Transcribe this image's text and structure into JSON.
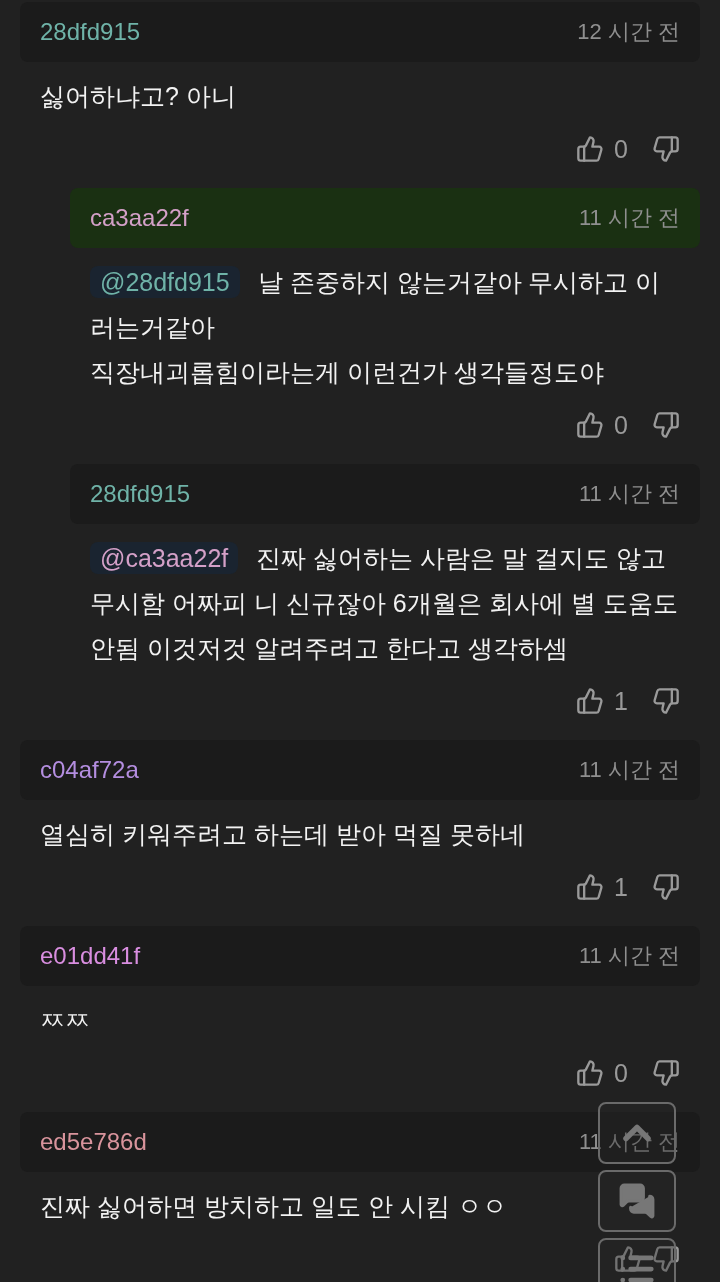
{
  "comments": [
    {
      "author": "28dfd915",
      "color": "#6fb3a8",
      "time": "12 시간 전",
      "highlighted": false,
      "body": "싫어하냐고? 아니",
      "likes": "0",
      "children": [
        {
          "author": "ca3aa22f",
          "color": "#d4a0c8",
          "time": "11 시간 전",
          "highlighted": true,
          "mention": {
            "text": "@28dfd915",
            "color": "#6fb3a8"
          },
          "body": "날 존중하지 않는거같아 무시하고 이러는거같아\n직장내괴롭힘이라는게 이런건가 생각들정도야",
          "likes": "0"
        },
        {
          "author": "28dfd915",
          "color": "#6fb3a8",
          "time": "11 시간 전",
          "highlighted": false,
          "mention": {
            "text": "@ca3aa22f",
            "color": "#d4a0c8"
          },
          "body": "진짜 싫어하는 사람은 말 걸지도 않고 무시함 어짜피 니 신규잖아 6개월은 회사에 별 도움도 안됨 이것저것 알려주려고 한다고 생각하셈",
          "likes": "1"
        }
      ]
    },
    {
      "author": "c04af72a",
      "color": "#b48ee0",
      "time": "11 시간 전",
      "highlighted": false,
      "body": "열심히 키워주려고 하는데 받아 먹질 못하네",
      "likes": "1"
    },
    {
      "author": "e01dd41f",
      "color": "#d98ee0",
      "time": "11 시간 전",
      "highlighted": false,
      "body": "ㅉㅉ",
      "likes": "0"
    },
    {
      "author": "ed5e786d",
      "color": "#d9949c",
      "time": "11 시간 전",
      "highlighted": false,
      "body": "진짜 싫어하면 방치하고 일도 안 시킴 ㅇㅇ"
    }
  ]
}
